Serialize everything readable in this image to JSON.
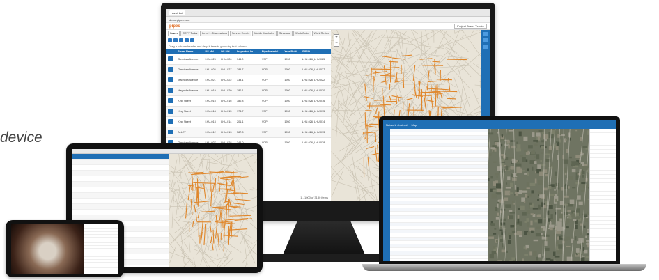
{
  "caption": "device",
  "colors": {
    "accent": "#1f6fb5",
    "brand": "#e06b20",
    "map_bg": "#e9e4d8",
    "street": "#e0862a"
  },
  "desktop": {
    "browser_tab": "Avail Lot",
    "url": "demo.pipes.com",
    "logo": "pipes",
    "project_label": "Project",
    "project_value": "Sewer Vendor",
    "tabs": [
      {
        "label": "Sewer"
      },
      {
        "label": "CCTV Tasks"
      },
      {
        "label": "Level 1 Observations"
      },
      {
        "label": "Service Events"
      },
      {
        "label": "Mobile Manholes"
      },
      {
        "label": "Structural"
      },
      {
        "label": "Work Order"
      },
      {
        "label": "Work Review"
      },
      {
        "label": "Assets"
      }
    ],
    "group_hint": "Drag a column header and drop it here to group by that column",
    "columns": [
      "Street Name",
      "US MH",
      "DS MH",
      "Inspected Le...",
      "Pipe Material",
      "Year Built",
      "GIS ID"
    ],
    "rows": [
      [
        "Glendora Avenue",
        "LHU-025",
        "LHU-026",
        "344.0",
        "VCP",
        "1950",
        "LHU-026_LHU-025"
      ],
      [
        "Glendora Avenue",
        "LHU-026",
        "LHU-027",
        "285.7",
        "VCP",
        "1950",
        "LHU-026_LHU-027"
      ],
      [
        "Magnolia Avenue",
        "LHU-021",
        "LHU-022",
        "338.1",
        "VCP",
        "1950",
        "LHU-026_LHU-022"
      ],
      [
        "Magnolia Avenue",
        "LHU-019",
        "LHU-020",
        "180.1",
        "VCP",
        "1950",
        "LHU-026_LHU-020"
      ],
      [
        "King Street",
        "LHU-015",
        "LHU-016",
        "380.8",
        "VCP",
        "1950",
        "LHU-026_LHU-016"
      ],
      [
        "King Street",
        "LHU-014",
        "LHU-015",
        "173.7",
        "VCP",
        "1950",
        "LHU-026_LHU-015"
      ],
      [
        "King Street",
        "LHU-013",
        "LHU-014",
        "201.1",
        "VCP",
        "1950",
        "LHU-026_LHU-014"
      ],
      [
        "ALLEY",
        "LHU-012",
        "LHU-013",
        "587.8",
        "VCP",
        "1950",
        "LHU-026_LHU-013"
      ],
      [
        "Glendora Avenue",
        "LHU-027",
        "LHU-028",
        "344.0",
        "VCP",
        "1950",
        "LHU-026_LHU-028"
      ]
    ],
    "pager": "1 - 1000 of 3180 items"
  },
  "laptop": {
    "title": "Network - Lateral",
    "map_label": "Map"
  },
  "icons": [
    "menu-icon",
    "edit-icon",
    "search-icon",
    "zoom-in-icon",
    "zoom-out-icon",
    "layers-icon",
    "plus-icon"
  ]
}
